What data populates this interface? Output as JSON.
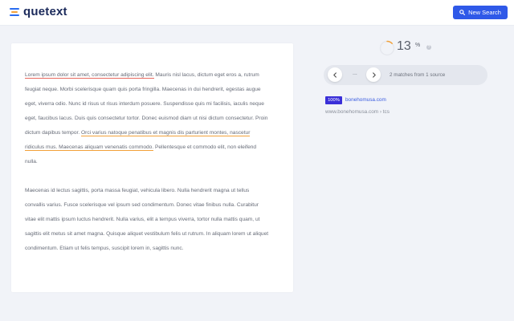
{
  "header": {
    "logo_text": "quetext",
    "new_search_label": "New Search"
  },
  "document": {
    "paragraph1": {
      "seg1": "Lorem ipsum dolor sit amet, consectetur adipiscing elit.",
      "seg2": " Mauris nisl lacus, dictum eget eros a, rutrum feugiat neque. Morbi scelerisque quam quis porta fringilla. Maecenas in dui hendrerit, egestas augue eget, viverra odio. Nunc id risus ut risus interdum posuere. Suspendisse quis mi facilisis, iaculis neque eget, faucibus lacus. Duis quis consectetur tortor. Donec euismod diam ut nisi dictum consectetur. Proin dictum dapibus tempor. ",
      "seg3": "Orci varius natoque penatibus et magnis dis parturient montes, nascetur ridiculus mus. Maecenas aliquam venenatis commodo.",
      "seg4": " Pellentesque et commodo elit, non eleifend nulla."
    },
    "paragraph2": "Maecenas id lectus sagittis, porta massa feugiat, vehicula libero. Nulla hendrerit magna ut tellus convallis varius. Fusce scelerisque vel ipsum sed condimentum. Donec vitae finibus nulla. Curabitur vitae elit mattis ipsum luctus hendrerit. Nulla varius, elit a tempus viverra, tortor nulla mattis quam, ut sagittis elit metus sit amet magna. Quisque aliquet vestibulum felis ut rutrum. In aliquam lorem ut aliquet condimentum. Etiam ut felis tempus, suscipit lorem in, sagittis nunc."
  },
  "score": {
    "value": "13",
    "unit": "%",
    "fraction": 0.13,
    "info_icon": "info-icon"
  },
  "matches": {
    "dots": "...",
    "summary": "2 matches from 1 source"
  },
  "source": {
    "badge": "100%",
    "domain": "bonehomusa.com",
    "path": "www.bonehomusa.com › tcs"
  },
  "colors": {
    "brand_blue": "#2f59e8",
    "highlight_red": "#e8685e",
    "highlight_orange": "#f2a13a",
    "badge_purple": "#3a2fd8"
  }
}
